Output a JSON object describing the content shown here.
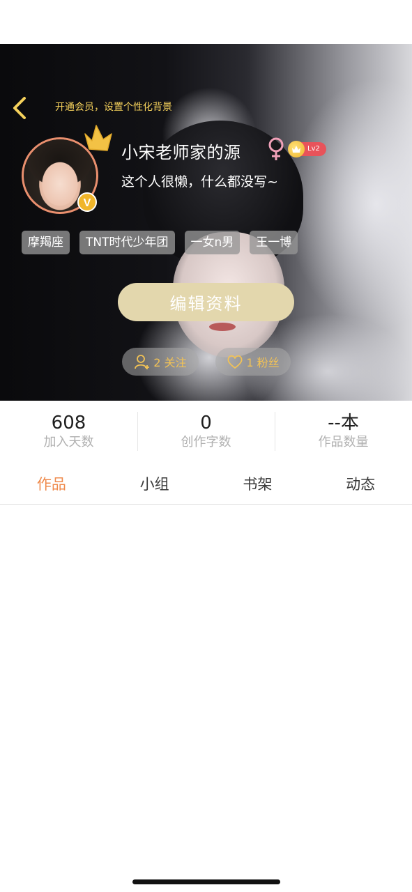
{
  "header": {
    "vip_hint": "开通会员，设置个性化背景",
    "username": "小宋老师家的源",
    "gender": "female",
    "level": "Lv2",
    "bio": "这个人很懒，什么都没写~",
    "tags": [
      "摩羯座",
      "TNT时代少年团",
      "一女n男",
      "王一博"
    ],
    "edit_button": "编辑资料",
    "follow_label": "2 关注",
    "fans_label": "1 粉丝"
  },
  "stats": [
    {
      "value": "608",
      "label": "加入天数"
    },
    {
      "value": "0",
      "label": "创作字数"
    },
    {
      "value": "--本",
      "label": "作品数量"
    }
  ],
  "tabs": [
    {
      "label": "作品",
      "active": true
    },
    {
      "label": "小组",
      "active": false
    },
    {
      "label": "书架",
      "active": false
    },
    {
      "label": "动态",
      "active": false
    }
  ],
  "colors": {
    "accent": "#ef8a4c",
    "gold": "#f6d25c",
    "edit_button_bg": "#e3d7ad",
    "gender_pink": "#f0a0b8",
    "level_red": "#e8535a"
  },
  "icons": {
    "back": "chevron-left-icon",
    "crown": "crown-icon",
    "verified": "v-badge-icon",
    "gender": "female-icon",
    "follow": "person-add-icon",
    "fans": "heart-icon"
  }
}
